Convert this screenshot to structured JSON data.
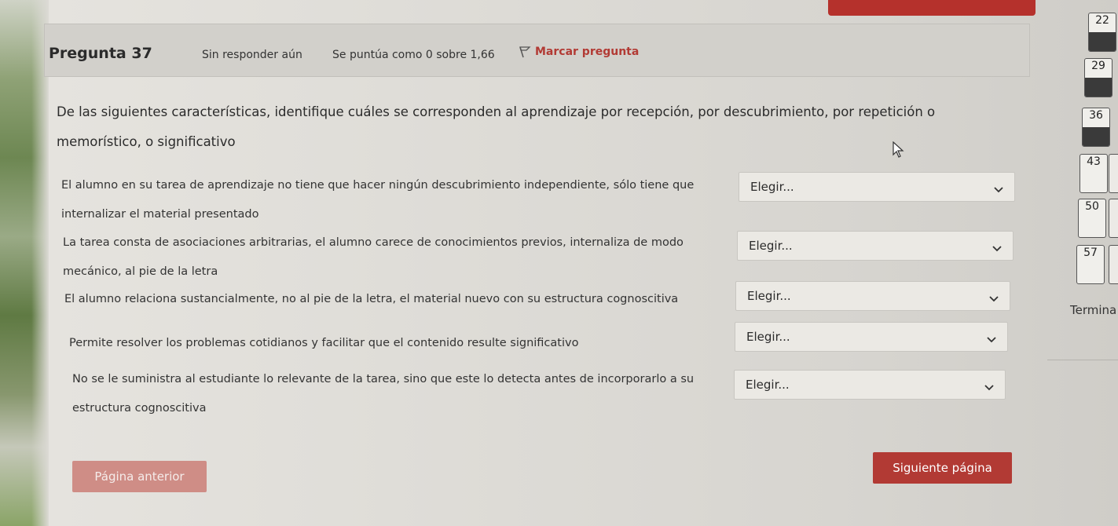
{
  "question": {
    "number_label": "Pregunta 37",
    "state": "Sin responder aún",
    "grade": "Se puntúa como 0 sobre 1,66",
    "flag_label": "Marcar pregunta",
    "text": "De las siguientes características, identifique cuáles se corresponden al aprendizaje por recepción, por descubrimiento, por repetición o memorístico, o significativo"
  },
  "rows": [
    {
      "text": "El alumno en su tarea de aprendizaje no tiene que hacer ningún descubrimiento independiente, sólo tiene que internalizar el material presentado",
      "select": "Elegir..."
    },
    {
      "text": "La tarea consta de asociaciones arbitrarias, el alumno carece de conocimientos previos, internaliza de modo mecánico, al pie de la letra",
      "select": "Elegir..."
    },
    {
      "text": "El alumno relaciona sustancialmente, no al pie de la letra, el material nuevo con su estructura cognoscitiva",
      "select": "Elegir..."
    },
    {
      "text": "Permite resolver los problemas cotidianos y facilitar que el contenido resulte significativo",
      "select": "Elegir..."
    },
    {
      "text": "No se le suministra al estudiante lo relevante de la tarea, sino que este lo detecta antes de incorporarlo a su estructura cognoscitiva",
      "select": "Elegir..."
    }
  ],
  "buttons": {
    "prev": "Página anterior",
    "next": "Siguiente página"
  },
  "nav": {
    "items": [
      "22",
      "29",
      "36",
      "43",
      "50",
      "57"
    ],
    "finish_label": "Termina"
  },
  "colors": {
    "accent": "#b23a34",
    "accent_light": "#cf8d86"
  }
}
